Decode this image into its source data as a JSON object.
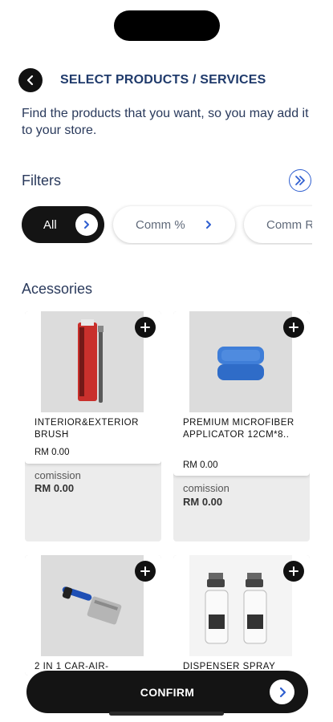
{
  "header": {
    "title": "SELECT PRODUCTS / SERVICES",
    "back_icon": "chevron-left-icon"
  },
  "subtitle": "Find the products that you want, so you may add it to your store.",
  "filters": {
    "label": "Filters",
    "toggle_icon": "double-chevron-right-icon",
    "chips": [
      {
        "label": "All",
        "selected": true
      },
      {
        "label": "Comm %",
        "selected": false
      },
      {
        "label": "Comm R",
        "selected": false
      }
    ]
  },
  "section": {
    "title": "Acessories"
  },
  "products": [
    {
      "name": "INTERIOR&EXTERIOR BRUSH",
      "price": "RM 0.00",
      "commission_label": "comission",
      "commission_value": "RM 0.00"
    },
    {
      "name": "PREMIUM MICROFIBER APPLICATOR 12CM*8..",
      "price": "RM 0.00",
      "commission_label": "comission",
      "commission_value": "RM 0.00"
    },
    {
      "name": "2 IN 1 CAR-AIR-",
      "price": "",
      "commission_label": "",
      "commission_value": ""
    },
    {
      "name": "DISPENSER SPRAY",
      "price": "",
      "commission_label": "",
      "commission_value": ""
    }
  ],
  "confirm_button": {
    "label": "CONFIRM"
  },
  "colors": {
    "accent": "#2f5fd0",
    "dark": "#141414",
    "title": "#1f3a6b"
  }
}
